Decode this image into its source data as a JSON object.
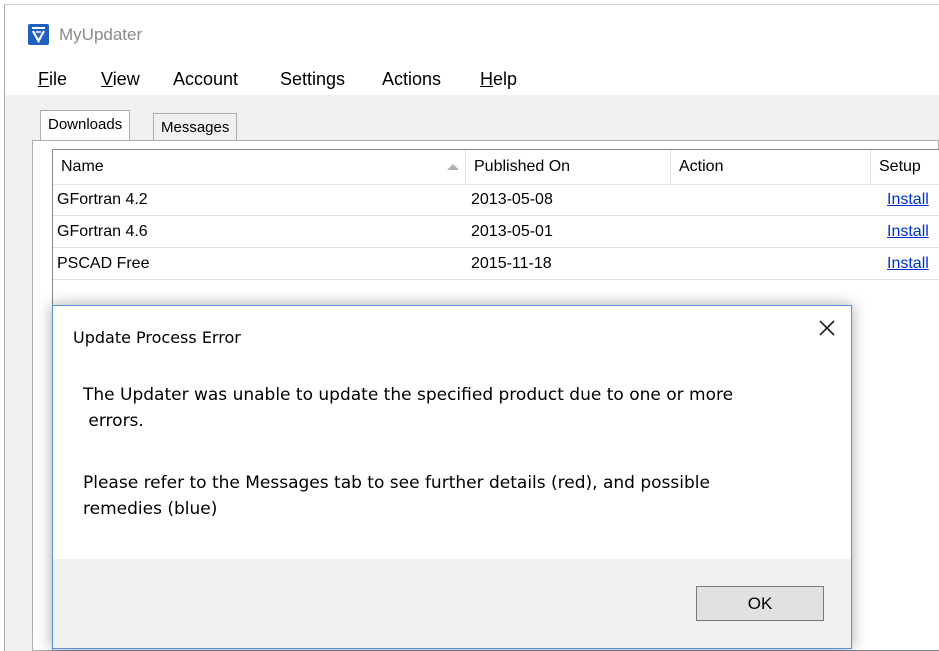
{
  "window": {
    "title": "MyUpdater",
    "icon": "app-logo-icon"
  },
  "menu": [
    {
      "label": "File",
      "mnemonic": "F"
    },
    {
      "label": "View",
      "mnemonic": "V"
    },
    {
      "label": "Account",
      "mnemonic": ""
    },
    {
      "label": "Settings",
      "mnemonic": ""
    },
    {
      "label": "Actions",
      "mnemonic": ""
    },
    {
      "label": "Help",
      "mnemonic": "H"
    }
  ],
  "tabs": [
    {
      "label": "Downloads",
      "active": true
    },
    {
      "label": "Messages",
      "active": false
    }
  ],
  "table": {
    "columns": [
      "Name",
      "Published On",
      "Action",
      "Setup"
    ],
    "sorted_column": "Name",
    "sort_direction": "ascending",
    "rows": [
      {
        "name": "GFortran 4.2",
        "published_on": "2013-05-08",
        "action": "",
        "setup": "Install"
      },
      {
        "name": "GFortran 4.6",
        "published_on": "2013-05-01",
        "action": "",
        "setup": "Install"
      },
      {
        "name": "PSCAD Free",
        "published_on": "2015-11-18",
        "action": "",
        "setup": "Install"
      }
    ]
  },
  "dialog": {
    "title": "Update Process Error",
    "message_line1": "The Updater was unable to update the specified product due to one or more",
    "message_line2": " errors.",
    "message_line3": "Please refer to the Messages tab to see further details (red), and possible",
    "message_line4": "remedies (blue)",
    "ok_label": "OK"
  },
  "colors": {
    "link": "#0033cc",
    "dialog_border": "#5b8fd3",
    "app_icon": "#1f5fbf"
  }
}
